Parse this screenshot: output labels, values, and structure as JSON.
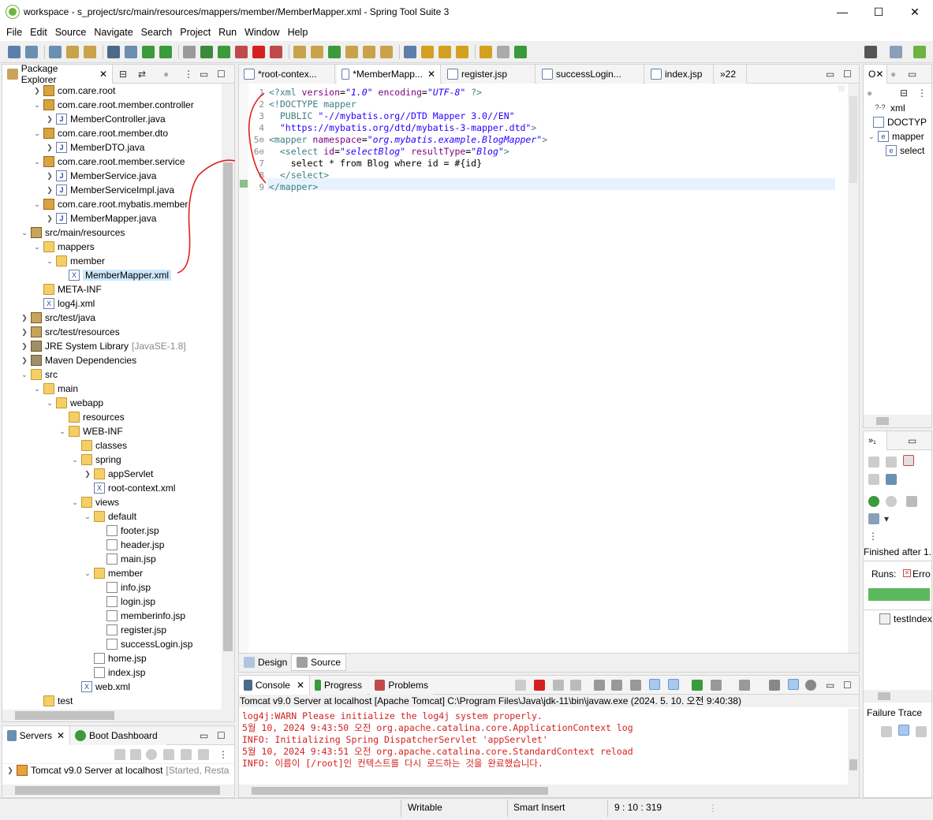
{
  "window": {
    "title": "workspace - s_project/src/main/resources/mappers/member/MemberMapper.xml - Spring Tool Suite 3",
    "minimize": "—",
    "maximize": "☐",
    "close": "✕"
  },
  "menu": [
    "File",
    "Edit",
    "Source",
    "Navigate",
    "Search",
    "Project",
    "Run",
    "Window",
    "Help"
  ],
  "package_explorer": {
    "title": "Package Explorer",
    "tree": [
      {
        "label": "com.care.root",
        "indent": 0,
        "tw": "❯",
        "icon": "pkg"
      },
      {
        "label": "com.care.root.member.controller",
        "indent": 0,
        "tw": "⌄",
        "icon": "pkg"
      },
      {
        "label": "MemberController.java",
        "indent": 1,
        "tw": "❯",
        "icon": "java"
      },
      {
        "label": "com.care.root.member.dto",
        "indent": 0,
        "tw": "⌄",
        "icon": "pkg"
      },
      {
        "label": "MemberDTO.java",
        "indent": 1,
        "tw": "❯",
        "icon": "java"
      },
      {
        "label": "com.care.root.member.service",
        "indent": 0,
        "tw": "⌄",
        "icon": "pkg"
      },
      {
        "label": "MemberService.java",
        "indent": 1,
        "tw": "❯",
        "icon": "java"
      },
      {
        "label": "MemberServiceImpl.java",
        "indent": 1,
        "tw": "❯",
        "icon": "java"
      },
      {
        "label": "com.care.root.mybatis.member",
        "indent": 0,
        "tw": "⌄",
        "icon": "pkg"
      },
      {
        "label": "MemberMapper.java",
        "indent": 1,
        "tw": "❯",
        "icon": "java"
      },
      {
        "label": "src/main/resources",
        "indent": -1,
        "tw": "⌄",
        "icon": "src"
      },
      {
        "label": "mappers",
        "indent": 0,
        "tw": "⌄",
        "icon": "folder"
      },
      {
        "label": "member",
        "indent": 1,
        "tw": "⌄",
        "icon": "folder"
      },
      {
        "label": "MemberMapper.xml",
        "indent": 2,
        "tw": "",
        "icon": "xml",
        "selected": true
      },
      {
        "label": "META-INF",
        "indent": 0,
        "tw": "",
        "icon": "folder"
      },
      {
        "label": "log4j.xml",
        "indent": 0,
        "tw": "",
        "icon": "xml"
      },
      {
        "label": "src/test/java",
        "indent": -1,
        "tw": "❯",
        "icon": "src"
      },
      {
        "label": "src/test/resources",
        "indent": -1,
        "tw": "❯",
        "icon": "src"
      },
      {
        "label": "JRE System Library",
        "indent": -1,
        "tw": "❯",
        "icon": "lib",
        "extra": "[JavaSE-1.8]"
      },
      {
        "label": "Maven Dependencies",
        "indent": -1,
        "tw": "❯",
        "icon": "lib"
      },
      {
        "label": "src",
        "indent": -1,
        "tw": "⌄",
        "icon": "folder"
      },
      {
        "label": "main",
        "indent": 0,
        "tw": "⌄",
        "icon": "folder"
      },
      {
        "label": "webapp",
        "indent": 1,
        "tw": "⌄",
        "icon": "folder"
      },
      {
        "label": "resources",
        "indent": 2,
        "tw": "",
        "icon": "folder"
      },
      {
        "label": "WEB-INF",
        "indent": 2,
        "tw": "⌄",
        "icon": "folder"
      },
      {
        "label": "classes",
        "indent": 3,
        "tw": "",
        "icon": "folder"
      },
      {
        "label": "spring",
        "indent": 3,
        "tw": "⌄",
        "icon": "folder"
      },
      {
        "label": "appServlet",
        "indent": 4,
        "tw": "❯",
        "icon": "folder"
      },
      {
        "label": "root-context.xml",
        "indent": 4,
        "tw": "",
        "icon": "xml"
      },
      {
        "label": "views",
        "indent": 3,
        "tw": "⌄",
        "icon": "folder"
      },
      {
        "label": "default",
        "indent": 4,
        "tw": "⌄",
        "icon": "folder"
      },
      {
        "label": "footer.jsp",
        "indent": 5,
        "tw": "",
        "icon": "jsp"
      },
      {
        "label": "header.jsp",
        "indent": 5,
        "tw": "",
        "icon": "jsp"
      },
      {
        "label": "main.jsp",
        "indent": 5,
        "tw": "",
        "icon": "jsp"
      },
      {
        "label": "member",
        "indent": 4,
        "tw": "⌄",
        "icon": "folder"
      },
      {
        "label": "info.jsp",
        "indent": 5,
        "tw": "",
        "icon": "jsp"
      },
      {
        "label": "login.jsp",
        "indent": 5,
        "tw": "",
        "icon": "jsp"
      },
      {
        "label": "memberinfo.jsp",
        "indent": 5,
        "tw": "",
        "icon": "jsp"
      },
      {
        "label": "register.jsp",
        "indent": 5,
        "tw": "",
        "icon": "jsp"
      },
      {
        "label": "successLogin.jsp",
        "indent": 5,
        "tw": "",
        "icon": "jsp"
      },
      {
        "label": "home.jsp",
        "indent": 4,
        "tw": "",
        "icon": "jsp"
      },
      {
        "label": "index.jsp",
        "indent": 4,
        "tw": "",
        "icon": "jsp"
      },
      {
        "label": "web.xml",
        "indent": 3,
        "tw": "",
        "icon": "xml"
      },
      {
        "label": "test",
        "indent": 0,
        "tw": "",
        "icon": "folder"
      }
    ]
  },
  "editor": {
    "tabs": [
      {
        "label": "*root-contex...",
        "active": false
      },
      {
        "label": "*MemberMapp...",
        "active": true
      },
      {
        "label": "register.jsp",
        "active": false
      },
      {
        "label": "successLogin...",
        "active": false
      },
      {
        "label": "index.jsp",
        "active": false
      },
      {
        "label": "»22",
        "active": false
      }
    ],
    "lines": [
      {
        "n": "1",
        "html": "<span class=\"c-pi\">&lt;?xml </span><span class=\"c-attr\">version</span>=<span class=\"c-val\">\"1.0\"</span> <span class=\"c-attr\">encoding</span>=<span class=\"c-val\">\"UTF-8\"</span> <span class=\"c-pi\">?&gt;</span>"
      },
      {
        "n": "2",
        "html": "<span class=\"c-dtd\">&lt;!DOCTYPE mapper</span>"
      },
      {
        "n": "3",
        "html": "  <span class=\"c-dtd\">PUBLIC </span><span class=\"c-val\" style=\"font-style:normal\">\"-//mybatis.org//DTD Mapper 3.0//EN\"</span>"
      },
      {
        "n": "4",
        "html": "  <span class=\"c-val\" style=\"font-style:normal\">\"https://mybatis.org/dtd/mybatis-3-mapper.dtd\"</span><span class=\"c-dtd\">&gt;</span>"
      },
      {
        "n": "5⊖",
        "html": "<span class=\"c-tag\">&lt;mapper </span><span class=\"c-attr\">namespace</span>=<span class=\"c-val\">\"org.mybatis.example.BlogMapper\"</span><span class=\"c-tag\">&gt;</span>"
      },
      {
        "n": "6⊖",
        "html": "  <span class=\"c-tag\">&lt;select </span><span class=\"c-attr\">id</span>=<span class=\"c-val\">\"selectBlog\"</span> <span class=\"c-attr\">resultType</span>=<span class=\"c-val\">\"Blog\"</span><span class=\"c-tag\">&gt;</span>"
      },
      {
        "n": "7",
        "html": "    select * from Blog where id = #{id}"
      },
      {
        "n": "8",
        "html": "  <span class=\"c-tag\">&lt;/select&gt;</span>"
      },
      {
        "n": "9",
        "html": "<span class=\"c-tag\">&lt;/mapper&gt;</span>"
      }
    ],
    "bottom_tabs": [
      "Design",
      "Source"
    ]
  },
  "outline": {
    "items": [
      {
        "label": "xml",
        "prefix": "?-?"
      },
      {
        "label": "DOCTYP",
        "prefix": ""
      },
      {
        "label": "mapper",
        "prefix": "e"
      },
      {
        "label": "select",
        "prefix": "e"
      }
    ]
  },
  "junit": {
    "tab": "»₁",
    "finished": "Finished after 1.",
    "runs_label": "Runs:",
    "errors_label": "Erro",
    "failure_trace": "Failure Trace",
    "test_item": "testIndex"
  },
  "console": {
    "tabs": [
      "Console",
      "Progress",
      "Problems"
    ],
    "header": "Tomcat v9.0 Server at localhost [Apache Tomcat] C:\\Program Files\\Java\\jdk-11\\bin\\javaw.exe  (2024. 5. 10. 오전 9:40:38)",
    "lines": [
      "log4j:WARN Please initialize the log4j system properly.",
      "5월 10, 2024 9:43:50 오전 org.apache.catalina.core.ApplicationContext log",
      "INFO: Initializing Spring DispatcherServlet 'appServlet'",
      "5월 10, 2024 9:43:51 오전 org.apache.catalina.core.StandardContext reload",
      "INFO: 이름이 [/root]인 컨텍스트를 다시 로드하는 것을 완료했습니다."
    ]
  },
  "servers": {
    "tabs": [
      "Servers",
      "Boot Dashboard"
    ],
    "item": "Tomcat v9.0 Server at localhost",
    "item_status": "[Started, Resta"
  },
  "status": {
    "writable": "Writable",
    "insert": "Smart Insert",
    "position": "9 : 10 : 319"
  },
  "colors": {
    "accent": "#0078d7",
    "selection": "#cce8ff",
    "junit_bar": "#5cb85c",
    "console_text": "#d42020",
    "annotation": "#e02020"
  }
}
